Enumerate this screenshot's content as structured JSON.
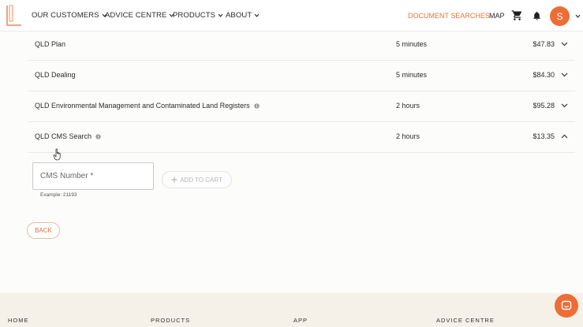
{
  "header": {
    "nav": [
      {
        "label": "OUR CUSTOMERS"
      },
      {
        "label": "ADVICE CENTRE"
      },
      {
        "label": "PRODUCTS"
      },
      {
        "label": "ABOUT"
      }
    ],
    "document_searches": "DOCUMENT SEARCHES",
    "map": "MAP",
    "avatar_initial": "S",
    "accent_color": "#ee6c35"
  },
  "rows": [
    {
      "name": "QLD Plan",
      "time": "5 minutes",
      "price": "$47.83",
      "info": false,
      "expanded": false
    },
    {
      "name": "QLD Dealing",
      "time": "5 minutes",
      "price": "$84.30",
      "info": false,
      "expanded": false
    },
    {
      "name": "QLD Environmental Management and Contaminated Land Registers",
      "time": "2 hours",
      "price": "$95.28",
      "info": true,
      "expanded": false
    },
    {
      "name": "QLD CMS Search",
      "time": "2 hours",
      "price": "$13.35",
      "info": true,
      "expanded": true
    }
  ],
  "form": {
    "cms_label": "CMS Number *",
    "cms_hint": "Example: 21193",
    "add_to_cart": "ADD TO CART"
  },
  "back_label": "BACK",
  "footer": {
    "columns": [
      "HOME",
      "PRODUCTS",
      "APP",
      "ADVICE CENTRE"
    ]
  }
}
